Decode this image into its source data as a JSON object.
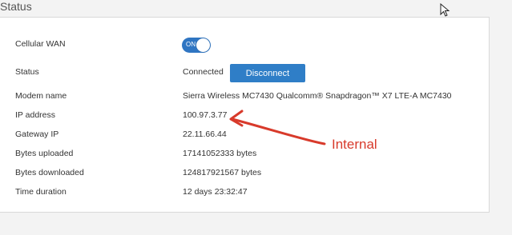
{
  "header": {
    "title": "Status"
  },
  "cellular_wan": {
    "label": "Cellular WAN",
    "toggle_text": "ON"
  },
  "status": {
    "label": "Status",
    "value": "Connected",
    "button": "Disconnect"
  },
  "rows": [
    {
      "label": "Modem name",
      "value": "Sierra Wireless MC7430 Qualcomm® Snapdragon™ X7 LTE-A MC7430"
    },
    {
      "label": "IP address",
      "value": "100.97.3.77"
    },
    {
      "label": "Gateway IP",
      "value": "22.11.66.44"
    },
    {
      "label": "Bytes uploaded",
      "value": "17141052333 bytes"
    },
    {
      "label": "Bytes downloaded",
      "value": "124817921567 bytes"
    },
    {
      "label": "Time duration",
      "value": "12 days 23:32:47"
    }
  ],
  "annotation": {
    "text": "Internal"
  },
  "colors": {
    "accent": "#2f7ec7",
    "annotation": "#d83a2b"
  }
}
